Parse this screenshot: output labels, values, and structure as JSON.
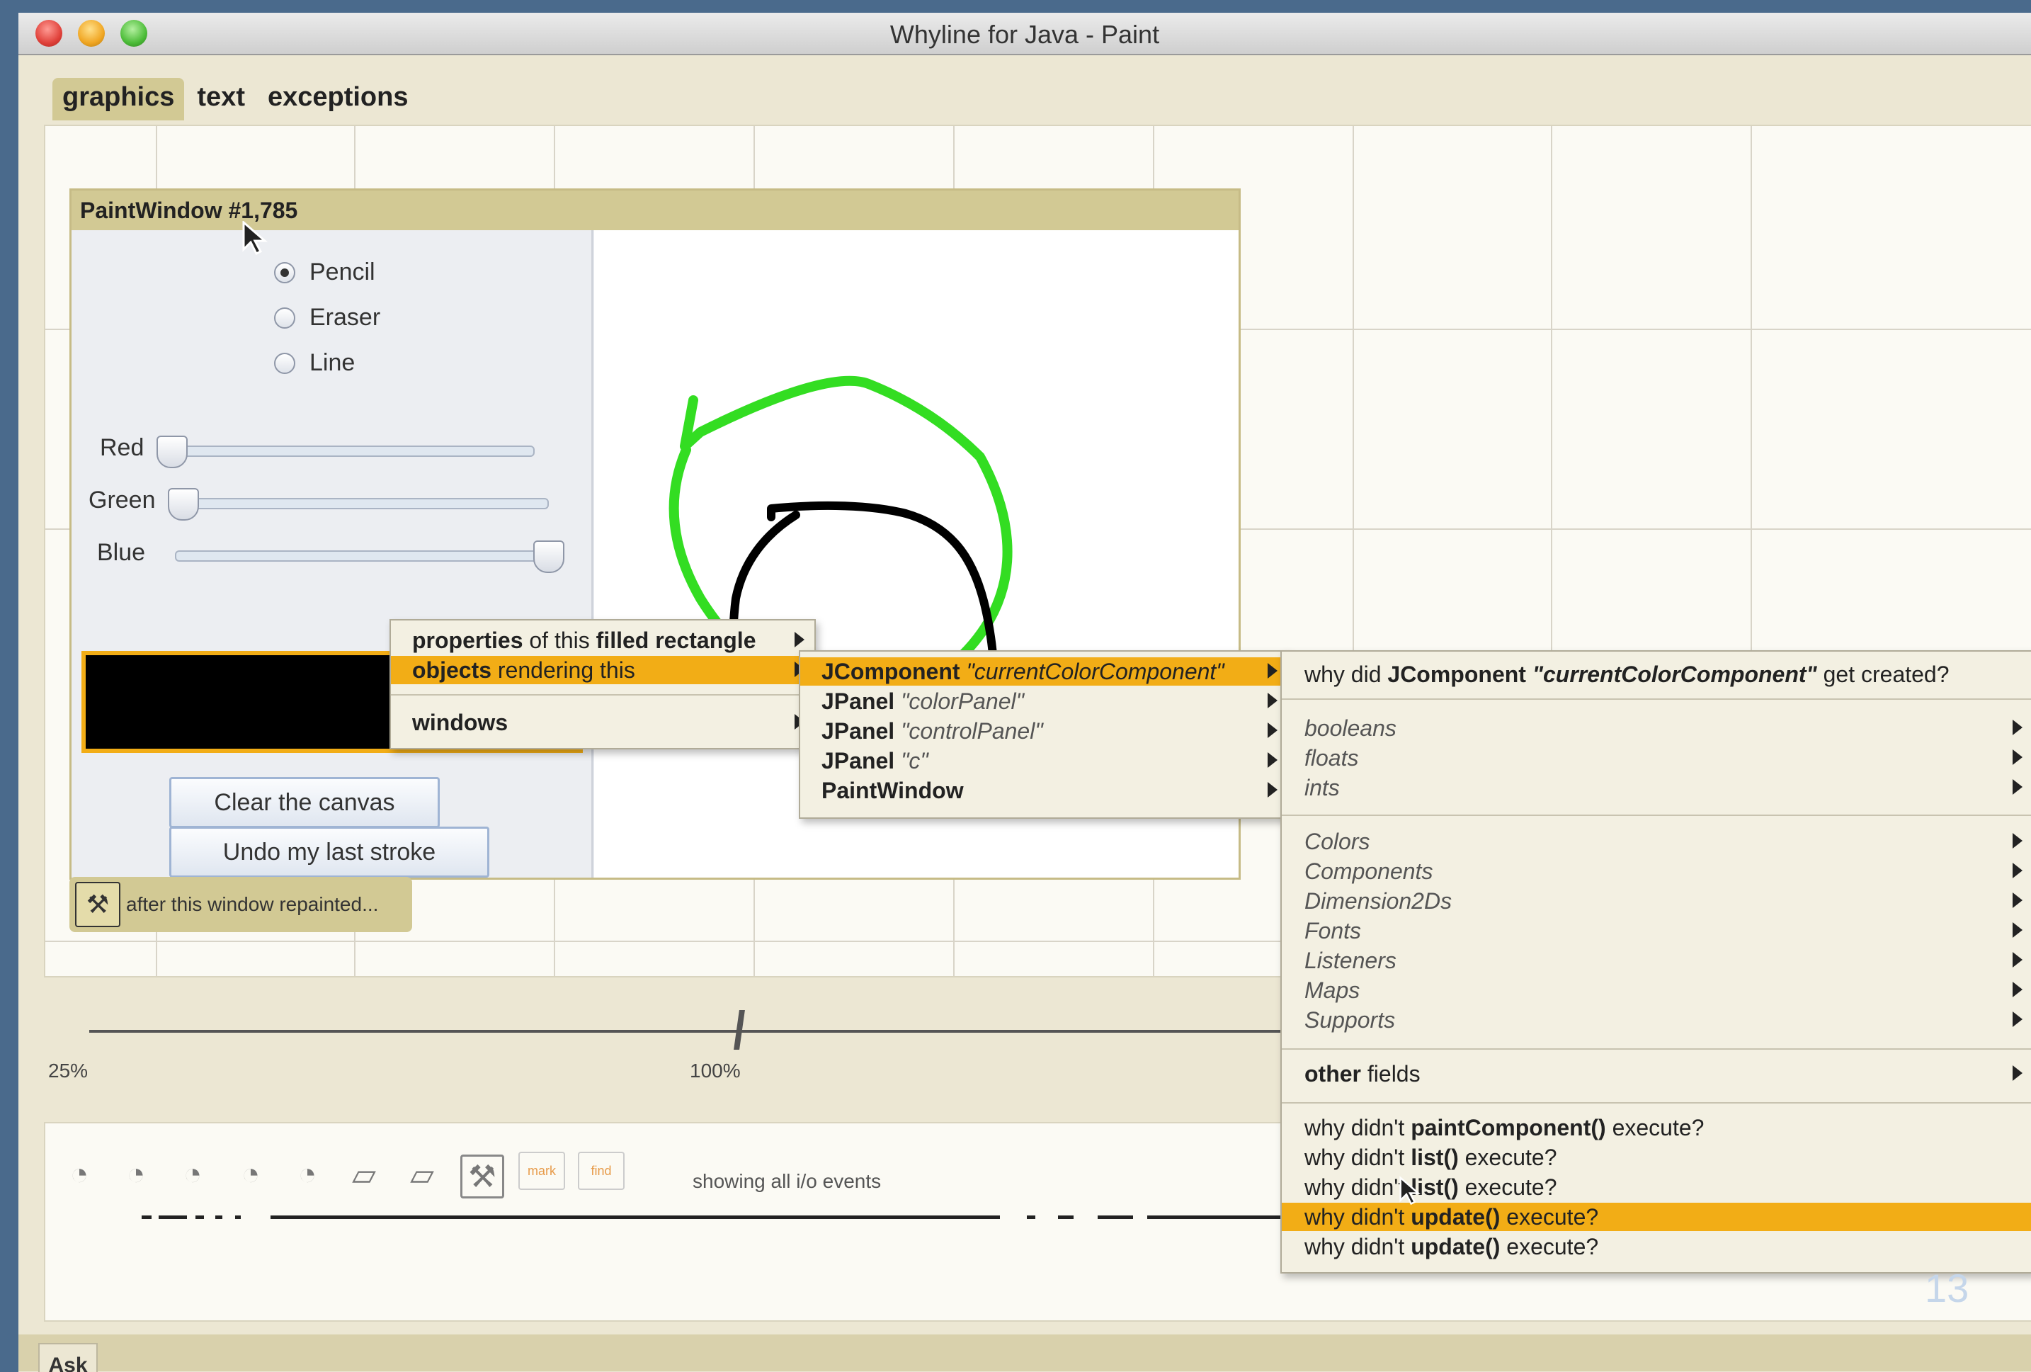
{
  "window": {
    "title": "Whyline for Java - Paint"
  },
  "tabs": [
    {
      "label": "graphics"
    },
    {
      "label": "text"
    },
    {
      "label": "exceptions"
    }
  ],
  "paint_window": {
    "title": "PaintWindow #1,785",
    "tools": [
      {
        "label": "Pencil",
        "selected": true
      },
      {
        "label": "Eraser",
        "selected": false
      },
      {
        "label": "Line",
        "selected": false
      }
    ],
    "sliders": [
      {
        "label": "Red",
        "value": 0
      },
      {
        "label": "Green",
        "value": 0
      },
      {
        "label": "Blue",
        "value": 1
      }
    ],
    "buttons": {
      "clear": "Clear the canvas",
      "undo": "Undo my last stroke"
    },
    "stroke_colors": [
      "#33dd22",
      "#000000"
    ]
  },
  "repaint": {
    "label": "after this window repainted..."
  },
  "zoom": {
    "min_label": "25%",
    "mid_label": "100%"
  },
  "timeline": {
    "status": "showing all i/o events",
    "box1": "mark",
    "box2": "find"
  },
  "menu1": {
    "item1_a": "properties",
    "item1_b": " of this ",
    "item1_c": "filled rectangle",
    "item2_a": "objects",
    "item2_b": " rendering this",
    "item3": "windows"
  },
  "menu2": {
    "items": [
      {
        "type": "JComponent",
        "name": "\"currentColorComponent\""
      },
      {
        "type": "JPanel",
        "name": "\"colorPanel\""
      },
      {
        "type": "JPanel",
        "name": "\"controlPanel\""
      },
      {
        "type": "JPanel",
        "name": "\"c\""
      },
      {
        "type": "PaintWindow",
        "name": ""
      }
    ]
  },
  "menu3": {
    "created_a": "why did ",
    "created_b": "JComponent",
    "created_c": "\"currentColorComponent\"",
    "created_d": " get created?",
    "primitives": [
      "booleans",
      "floats",
      "ints"
    ],
    "objects": [
      "Colors",
      "Components",
      "Dimension2Ds",
      "Fonts",
      "Listeners",
      "Maps",
      "Supports"
    ],
    "other_a": "other",
    "other_b": " fields",
    "why_prefix": "why didn't ",
    "why_suffix": " execute?",
    "whys": [
      "paintComponent()",
      "list()",
      "list()",
      "update()",
      "update()"
    ]
  },
  "bottom": {
    "ask": "Ask"
  },
  "slide_number": "13",
  "accent": "#f2ad16"
}
